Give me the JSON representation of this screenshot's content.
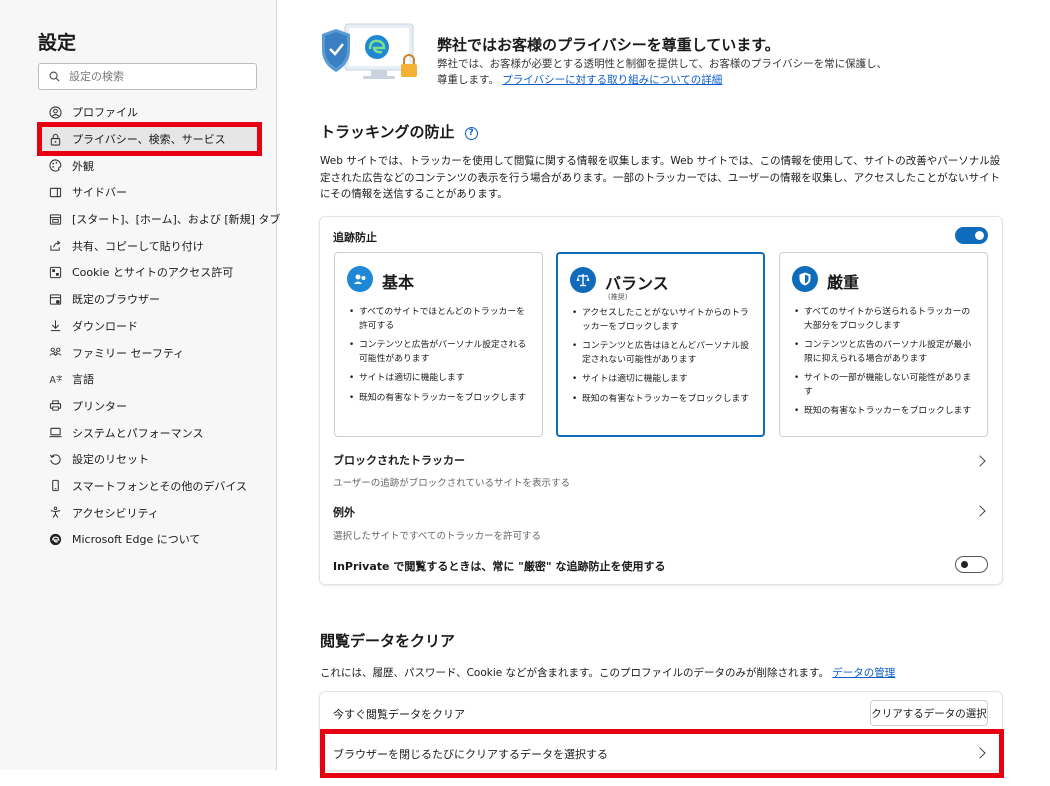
{
  "sidebar": {
    "title": "設定",
    "search_placeholder": "設定の検索",
    "items": [
      {
        "label": "プロファイル",
        "icon": "profile-icon"
      },
      {
        "label": "プライバシー、検索、サービス",
        "icon": "lock-icon"
      },
      {
        "label": "外観",
        "icon": "appearance-icon"
      },
      {
        "label": "サイドバー",
        "icon": "sidebar-icon"
      },
      {
        "label": "[スタート]、[ホーム]、および [新規] タブ",
        "icon": "tabs-icon"
      },
      {
        "label": "共有、コピーして貼り付け",
        "icon": "share-icon"
      },
      {
        "label": "Cookie とサイトのアクセス許可",
        "icon": "cookie-icon"
      },
      {
        "label": "既定のブラウザー",
        "icon": "browser-icon"
      },
      {
        "label": "ダウンロード",
        "icon": "download-icon"
      },
      {
        "label": "ファミリー セーフティ",
        "icon": "family-icon"
      },
      {
        "label": "言語",
        "icon": "language-icon"
      },
      {
        "label": "プリンター",
        "icon": "printer-icon"
      },
      {
        "label": "システムとパフォーマンス",
        "icon": "system-icon"
      },
      {
        "label": "設定のリセット",
        "icon": "reset-icon"
      },
      {
        "label": "スマートフォンとその他のデバイス",
        "icon": "phone-icon"
      },
      {
        "label": "アクセシビリティ",
        "icon": "accessibility-icon"
      },
      {
        "label": "Microsoft Edge について",
        "icon": "edge-icon"
      }
    ]
  },
  "hero": {
    "title": "弊社ではお客様のプライバシーを尊重しています。",
    "text": "弊社では、お客様が必要とする透明性と制御を提供して、お客様のプライバシーを常に保護し、尊重します。",
    "link": "プライバシーに対する取り組みについての詳細"
  },
  "tracking": {
    "title": "トラッキングの防止",
    "help": "?",
    "description": "Web サイトでは、トラッカーを使用して閲覧に関する情報を収集します。Web サイトでは、この情報を使用して、サイトの改善やパーソナル設定された広告などのコンテンツの表示を行う場合があります。一部のトラッカーでは、ユーザーの情報を収集し、アクセスしたことがないサイトにその情報を送信することがあります。",
    "toggle_label": "追跡防止",
    "toggle_on": true,
    "options": [
      {
        "name": "基本",
        "recommended": "",
        "bullets": [
          "すべてのサイトでほとんどのトラッカーを許可する",
          "コンテンツと広告がパーソナル設定される可能性があります",
          "サイトは適切に機能します",
          "既知の有害なトラッカーをブロックします"
        ]
      },
      {
        "name": "バランス",
        "recommended": "(推奨)",
        "bullets": [
          "アクセスしたことがないサイトからのトラッカーをブロックします",
          "コンテンツと広告はほとんどパーソナル設定されない可能性があります",
          "サイトは適切に機能します",
          "既知の有害なトラッカーをブロックします"
        ]
      },
      {
        "name": "厳重",
        "recommended": "",
        "bullets": [
          "すべてのサイトから送られるトラッカーの大部分をブロックします",
          "コンテンツと広告のパーソナル設定が最小限に抑えられる場合があります",
          "サイトの一部が機能しない可能性があります",
          "既知の有害なトラッカーをブロックします"
        ]
      }
    ],
    "selected_option": "バランス",
    "blocked": {
      "label": "ブロックされたトラッカー",
      "sub": "ユーザーの追跡がブロックされているサイトを表示する"
    },
    "exceptions": {
      "label": "例外",
      "sub": "選択したサイトですべてのトラッカーを許可する"
    },
    "inprivate": {
      "label": "InPrivate で閲覧するときは、常に \"厳密\" な追跡防止を使用する",
      "on": false
    }
  },
  "clear": {
    "title": "閲覧データをクリア",
    "description": "これには、履歴、パスワード、Cookie などが含まれます。このプロファイルのデータのみが削除されます。",
    "manage_link": "データの管理",
    "now_label": "今すぐ閲覧データをクリア",
    "choose_button": "クリアするデータの選択",
    "on_close_label": "ブラウザーを閉じるたびにクリアするデータを選択する"
  },
  "colors": {
    "accent": "#0f6cbd",
    "highlight": "#e60012"
  }
}
